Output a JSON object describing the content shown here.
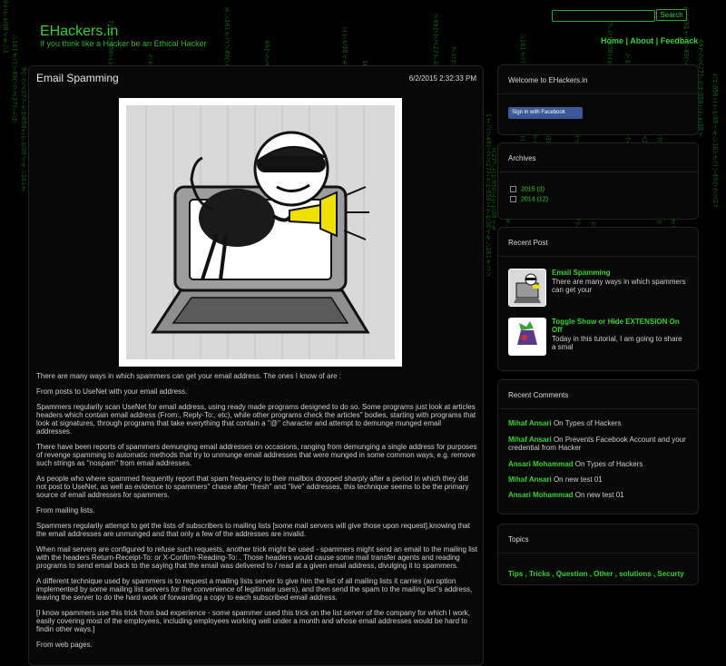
{
  "header": {
    "site_title": "EHackers.in",
    "tagline": "If you think like a Hacker be an Ethical Hacker",
    "search_button": "Search",
    "nav": [
      "Home",
      "About",
      "Feedback"
    ]
  },
  "post": {
    "title": "Email Spamming",
    "date": "6/2/2015 2:32:33 PM",
    "paragraphs": [
      "There are many ways in which spammers can get your email address. The ones I know of are :",
      "From posts to UseNet with your email address.",
      "Spammers regularily scan UseNet for email address, using ready made programs designed to do so. Some programs just look at articles headers which contain email address (From:, Reply-To:, etc), while other programs check the articles'' bodies, starting with programs that look at signatures, through programs that take everything that contain a ''@'' character and attempt to demunge munged email addresses.",
      "There have been reports of spammers demunging email addresses on occasions, ranging from demunging a single address for purposes of revenge spamming to automatic methods that try to unmunge email addresses that were munged in some common ways, e.g. remove such strings as ''nospam'' from email addresses.",
      "As people who where spammed frequently report that spam frequency to their mailbox dropped sharply after a period in which they did not post to UseNet, as well as evidence to spammers'' chase after ''fresh'' and ''live'' addresses, this technique seems to be the primary source of email addresses for spammers.",
      "From mailing lists.",
      "Spammers regularily attempt to get the lists of subscribers to mailing lists [some mail servers will give those upon request],knowing that the email addresses are unmunged and that only a few of the addresses are invalid.",
      "When mail servers are configured to refuse such requests, another trick might be used - spammers might send an email to the mailing list with the headers Return-Receipt-To: or X-Confirm-Reading-To: . Those headers would cause some mail transfer agents and reading programs to send email back to the saying that the email was delivered to / read at a given email address, divulging it to spammers.",
      "A different technique used by spammers is to request a mailing lists server to give him the list of all mailing lists it carries (an option implemented by some mailing list servers for the convenience of legitimate users), and then send the spam to the mailing list''s address, leaving the server to do the hard work of forwarding a copy to each subscribed email address.",
      "[I know spammers use this trick from bad experience - some spammer used this trick on the list server of the company for which I work, easily covering most of the employees, including employees working well under a month and whose email addresses would be hard to findin other ways.]",
      "From web pages."
    ]
  },
  "sidebar": {
    "welcome": {
      "title": "Welcome to EHackers.in",
      "fb_button": "Sign in with Facebook"
    },
    "archives": {
      "title": "Archives",
      "items": [
        "2015 (3)",
        "2014 (12)"
      ]
    },
    "recent_posts": {
      "title": "Recent Post",
      "items": [
        {
          "title": "Email Spamming",
          "excerpt": "There are many ways in which spammers can get your"
        },
        {
          "title": "Toggle Show or Hide EXTENSION On Off",
          "excerpt": "Today in this tutorial, I am going to share a smal"
        }
      ]
    },
    "recent_comments": {
      "title": "Recent Comments",
      "items": [
        {
          "user": "Mihaf Ansari",
          "text": " On Types of Hackers"
        },
        {
          "user": "Mihaf Ansari",
          "text": " On Prevents Facebook Account and your credential from Hacker"
        },
        {
          "user": "Ansari Mohammad",
          "text": " On Types of Hackers"
        },
        {
          "user": "Mihaf Ansari",
          "text": " On new test 01"
        },
        {
          "user": "Ansari Mohammad",
          "text": " On new test 01"
        }
      ]
    },
    "topics": {
      "title": "Topics",
      "items": [
        "Tips",
        "Tricks",
        "Question",
        "Other",
        "solutions",
        "Securty"
      ]
    }
  },
  "colors": {
    "accent": "#2fd12f",
    "background": "#000000",
    "panel": "#080808"
  }
}
